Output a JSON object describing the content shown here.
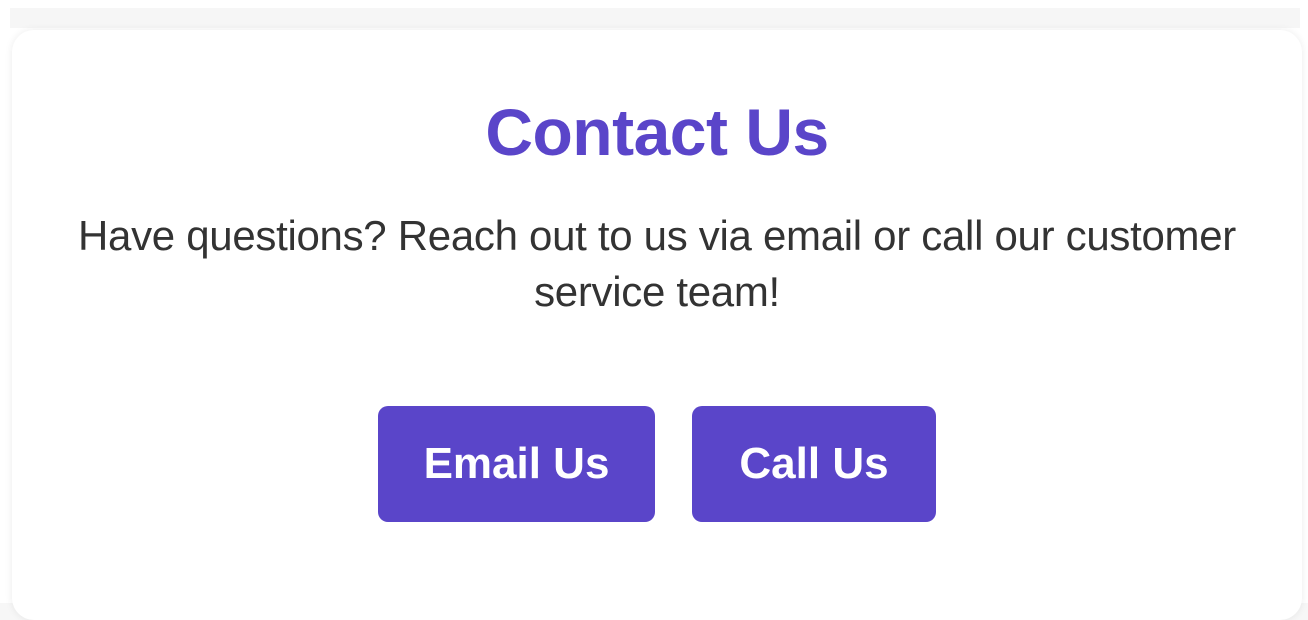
{
  "contact": {
    "title": "Contact Us",
    "description": "Have questions? Reach out to us via email or call our customer service team!",
    "buttons": {
      "email_label": "Email Us",
      "call_label": "Call Us"
    }
  },
  "colors": {
    "accent": "#5a45c9",
    "text": "#333333",
    "background": "#ffffff"
  }
}
